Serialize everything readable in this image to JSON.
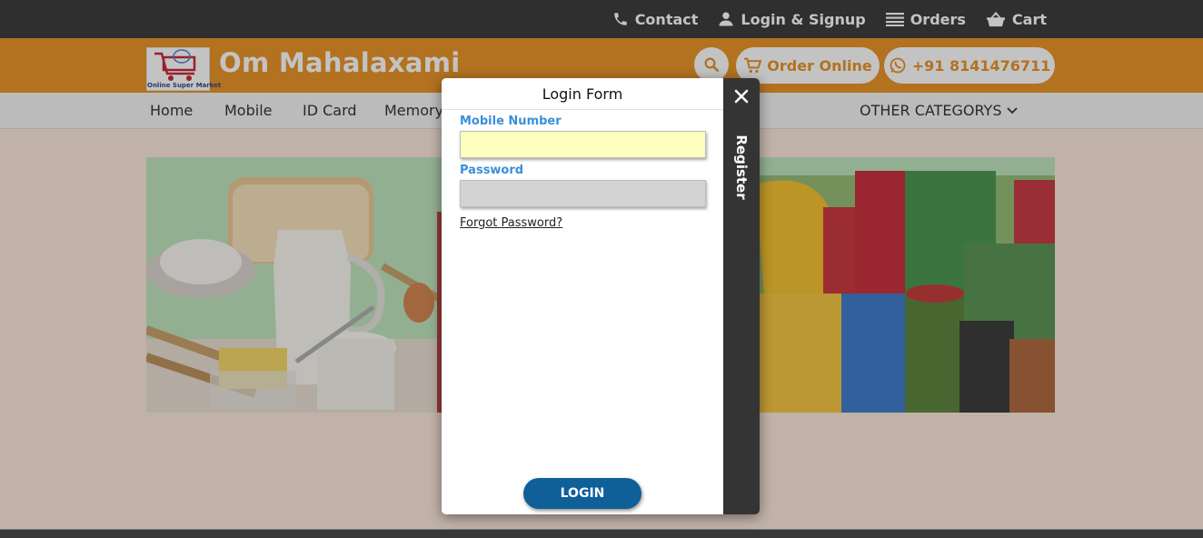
{
  "topbar": {
    "contact_label": "Contact",
    "login_label": "Login & Signup",
    "orders_label": "Orders",
    "cart_label": "Cart"
  },
  "header": {
    "brand_name": "Om Mahalaxami",
    "logo_caption": "Online Super Market",
    "order_online_label": "Order Online",
    "phone_label": "+91 8141476711"
  },
  "nav": {
    "items": [
      "Home",
      "Mobile",
      "ID Card",
      "Memory"
    ],
    "other_categories_label": "OTHER CATEGORYS"
  },
  "modal": {
    "title": "Login Form",
    "mobile_label": "Mobile Number",
    "mobile_value": "",
    "password_label": "Password",
    "password_value": "",
    "forgot_label": "Forgot Password?",
    "login_button": "LOGIN",
    "register_label": "Register"
  },
  "colors": {
    "accent_orange": "#e58b16",
    "topbar_dark": "#2b2b2b",
    "login_button_blue": "#0f5f98",
    "label_blue": "#3b8fd8",
    "mobile_field_bg": "#fcffc0",
    "password_field_bg": "#d3d3d3",
    "side_panel_dark": "#343434"
  }
}
